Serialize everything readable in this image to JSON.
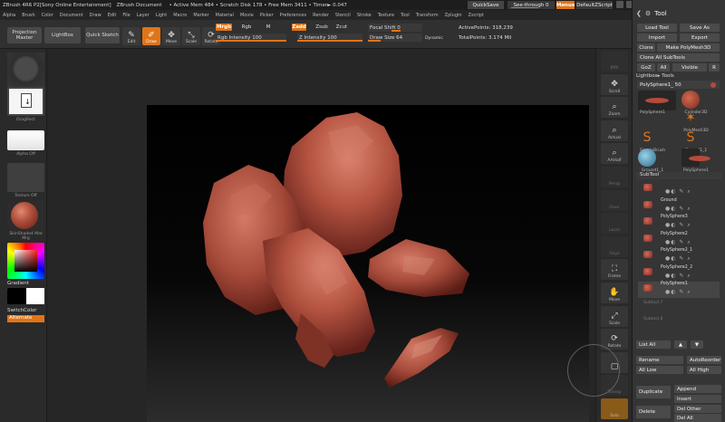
{
  "titlebar": {
    "app": "ZBrush 4R6 P2[Sony Online Entertainment]",
    "doc": "ZBrush Document",
    "info": "• Active Mem 484 • Scratch Disk 178 • Free Mem 3411 • Timer► 0.047",
    "quicksave": "QuickSave",
    "seethrough": "See-through 0",
    "menus": "Menus",
    "defaultscript": "DefaultZScript"
  },
  "menubar": [
    "Alpha",
    "Brush",
    "Color",
    "Document",
    "Draw",
    "Edit",
    "File",
    "Layer",
    "Light",
    "Macro",
    "Marker",
    "Material",
    "Movie",
    "Picker",
    "Preferences",
    "Render",
    "Stencil",
    "Stroke",
    "Texture",
    "Tool",
    "Transform",
    "Zplugin",
    "Zscript"
  ],
  "shelf": {
    "projection_master": "Projection Master",
    "lightbox": "LightBox",
    "quick_sketch": "Quick Sketch",
    "tools": [
      {
        "label": "Edit",
        "glyph": "✎",
        "active": false
      },
      {
        "label": "Draw",
        "glyph": "✐",
        "active": true
      },
      {
        "label": "Move",
        "glyph": "✥",
        "active": false
      },
      {
        "label": "Scale",
        "glyph": "⤡",
        "active": false
      },
      {
        "label": "Rotate",
        "glyph": "⟳",
        "active": false
      }
    ],
    "mrgb": "Mrgb",
    "rgb": "Rgb",
    "m": "M",
    "rgb_intensity": "Rgb Intensity 100",
    "zadd": "Zadd",
    "zsub": "Zsub",
    "zcut": "Zcut",
    "z_intensity": "Z Intensity 100",
    "focal_shift": "Focal Shift 0",
    "draw_size": "Draw Size 64",
    "dynamic": "Dynamic",
    "active_points": "ActivePoints: 318,239",
    "total_points": "TotalPoints: 3.174 Mil"
  },
  "leftpanel": {
    "brush_label": "",
    "stroke_label": "DragRect",
    "alpha_label": "Alpha Off",
    "texture_label": "Texture Off",
    "material_label": "SkinShade4 Mat Mrg",
    "gradient": "Gradient",
    "switchcolor": "SwitchColor",
    "alternate": "Alternate"
  },
  "rshelf": {
    "buttons": [
      {
        "label": "BPR",
        "glyph": "",
        "dim": true
      },
      {
        "label": "Scroll",
        "glyph": "✥",
        "dim": false
      },
      {
        "label": "Zoom",
        "glyph": "⌕",
        "dim": false
      },
      {
        "label": "Actual",
        "glyph": "⌕",
        "dim": false
      },
      {
        "label": "AAHalf",
        "glyph": "⌕",
        "dim": false
      },
      {
        "label": "Persp",
        "glyph": "",
        "dim": true
      },
      {
        "label": "Floor",
        "glyph": "",
        "dim": true
      },
      {
        "label": "Local",
        "glyph": "",
        "dim": true
      },
      {
        "label": "Gxyz",
        "glyph": "",
        "dim": true
      },
      {
        "label": "Frame",
        "glyph": "⛶",
        "dim": false
      },
      {
        "label": "Move",
        "glyph": "✋",
        "dim": false
      },
      {
        "label": "Scale",
        "glyph": "⤢",
        "dim": false
      },
      {
        "label": "Rotate",
        "glyph": "⟳",
        "dim": false
      },
      {
        "label": "",
        "glyph": "▢",
        "dim": false
      },
      {
        "label": "Transp",
        "glyph": "",
        "dim": true
      },
      {
        "label": "Solo",
        "glyph": "",
        "dim": false
      }
    ]
  },
  "palette": {
    "title": "Tool",
    "load_tool": "Load Tool",
    "save_as": "Save As",
    "import": "Import",
    "export": "Export",
    "clone": "Clone",
    "make_polymesh": "Make PolyMesh3D",
    "clone_all": "Clone All SubTools",
    "goz": "GoZ",
    "all": "All",
    "visible": "Visible",
    "r": "R",
    "lightbox_tools": "Lightbox▸ Tools",
    "current_tool": "PolySphere1_ 50",
    "thumbs": [
      {
        "label": "PolySphere1"
      },
      {
        "label": "Cylinder3D"
      },
      {
        "label": "PolyMesh3D"
      },
      {
        "label": "SimpleBrush"
      },
      {
        "label": "Ground1_1"
      },
      {
        "label": "Ground1_1"
      },
      {
        "label": "PolySphere1"
      }
    ],
    "subtool_header": "SubTool",
    "subtools": [
      "",
      "Ground",
      "PolySphere3",
      "PolySphere2",
      "PolySphere2_1",
      "PolySphere2_2",
      "PolySphere1"
    ],
    "subtool_empty": [
      "Subtool 7",
      "Subtool 8"
    ],
    "list_all": "List All",
    "rename": "Rename",
    "autoreorder": "AutoReorder",
    "all_low": "All Low",
    "all_high": "All High",
    "duplicate": "Duplicate",
    "append": "Append",
    "insert": "Insert",
    "delete": "Delete",
    "del_other": "Del Other",
    "del_all": "Del All"
  }
}
